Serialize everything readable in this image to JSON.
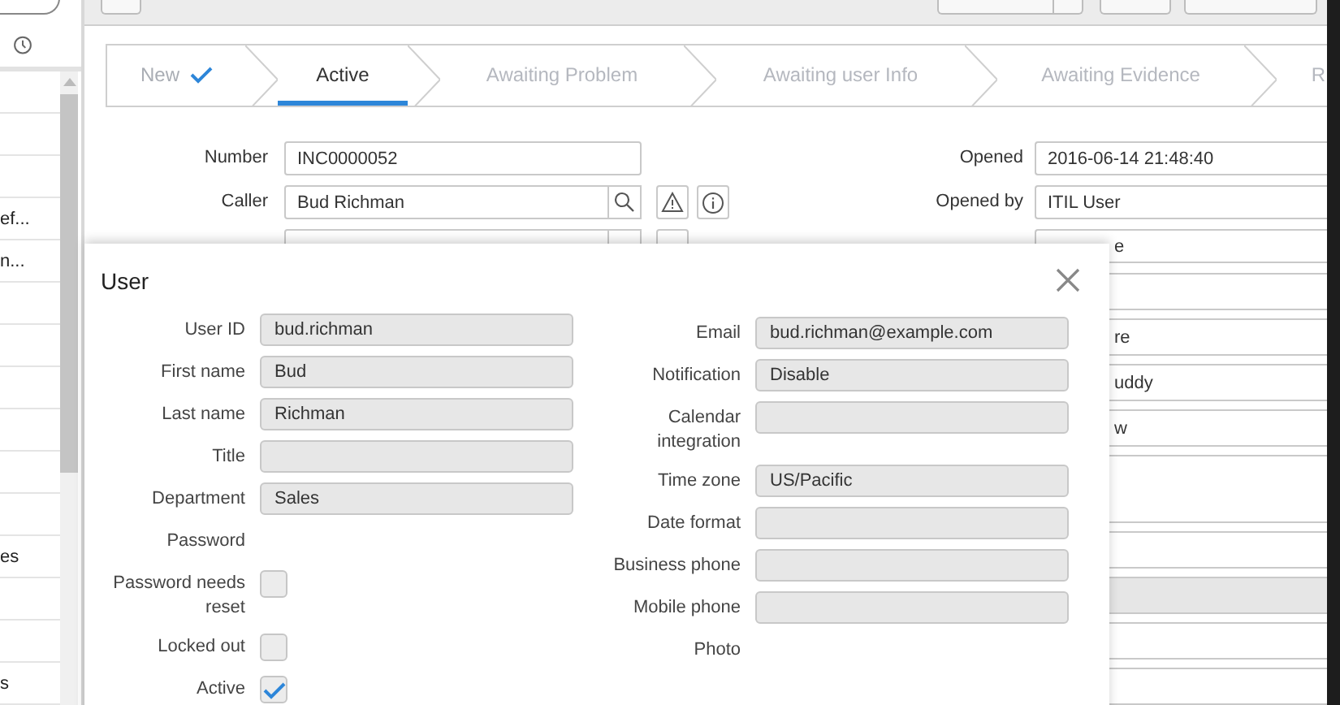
{
  "sidebar": {
    "items": [
      {
        "kind": "blank"
      },
      {
        "kind": "blank"
      },
      {
        "kind": "blank"
      },
      {
        "kind": "text",
        "label": "ef..."
      },
      {
        "kind": "text",
        "label": "n..."
      },
      {
        "kind": "blank"
      },
      {
        "kind": "blank"
      },
      {
        "kind": "blank"
      },
      {
        "kind": "blank"
      },
      {
        "kind": "blank"
      },
      {
        "kind": "blank"
      },
      {
        "kind": "text",
        "label": "es"
      },
      {
        "kind": "blank"
      },
      {
        "kind": "blank"
      },
      {
        "kind": "text",
        "label": "s"
      }
    ]
  },
  "stepper": {
    "steps": [
      {
        "label": "New",
        "done": true,
        "selected": false
      },
      {
        "label": "Active",
        "done": false,
        "selected": true
      },
      {
        "label": "Awaiting Problem",
        "done": false,
        "selected": false
      },
      {
        "label": "Awaiting user Info",
        "done": false,
        "selected": false
      },
      {
        "label": "Awaiting Evidence",
        "done": false,
        "selected": false
      },
      {
        "label": "R",
        "done": false,
        "selected": false
      }
    ]
  },
  "form": {
    "rows": [
      {
        "left": {
          "kind": "text",
          "label": "Number",
          "value": "INC0000052"
        },
        "right": {
          "kind": "field",
          "label": "Opened",
          "value": "2016-06-14 21:48:40"
        }
      },
      {
        "left": {
          "kind": "reference",
          "label": "Caller",
          "value": "Bud Richman"
        },
        "right": {
          "kind": "field",
          "label": "Opened by",
          "value": "ITIL User"
        }
      },
      {
        "left": {
          "kind": "lookup"
        },
        "right": {
          "kind": "field",
          "value": "e"
        }
      }
    ],
    "lower_right_fields": [
      {
        "kind": "field"
      },
      {
        "kind": "field",
        "value": "re"
      },
      {
        "kind": "field",
        "value": "uddy"
      },
      {
        "kind": "field",
        "value": "w"
      },
      {
        "kind": "textarea"
      },
      {
        "kind": "field"
      },
      {
        "kind": "readonly"
      },
      {
        "kind": "field"
      },
      {
        "kind": "field"
      }
    ]
  },
  "modal": {
    "title": "User",
    "left": [
      {
        "kind": "input",
        "label": "User ID",
        "value": "bud.richman"
      },
      {
        "kind": "input",
        "label": "First name",
        "value": "Bud"
      },
      {
        "kind": "input",
        "label": "Last name",
        "value": "Richman"
      },
      {
        "kind": "input",
        "label": "Title"
      },
      {
        "kind": "input",
        "label": "Department",
        "value": "Sales"
      },
      {
        "kind": "plain",
        "label": "Password"
      },
      {
        "kind": "checkbox",
        "label": "Password needs reset",
        "checked": false
      },
      {
        "kind": "checkbox",
        "label": "Locked out",
        "checked": false
      },
      {
        "kind": "checkbox",
        "label": "Active",
        "checked": true
      }
    ],
    "right": [
      {
        "kind": "input",
        "label": "Email",
        "value": "bud.richman@example.com"
      },
      {
        "kind": "input",
        "label": "Notification",
        "value": "Disable"
      },
      {
        "kind": "input",
        "label": "Calendar integration"
      },
      {
        "kind": "input",
        "label": "Time zone",
        "value": "US/Pacific"
      },
      {
        "kind": "input",
        "label": "Date format"
      },
      {
        "kind": "input",
        "label": "Business phone"
      },
      {
        "kind": "input",
        "label": "Mobile phone"
      },
      {
        "kind": "plain",
        "label": "Photo"
      }
    ]
  }
}
